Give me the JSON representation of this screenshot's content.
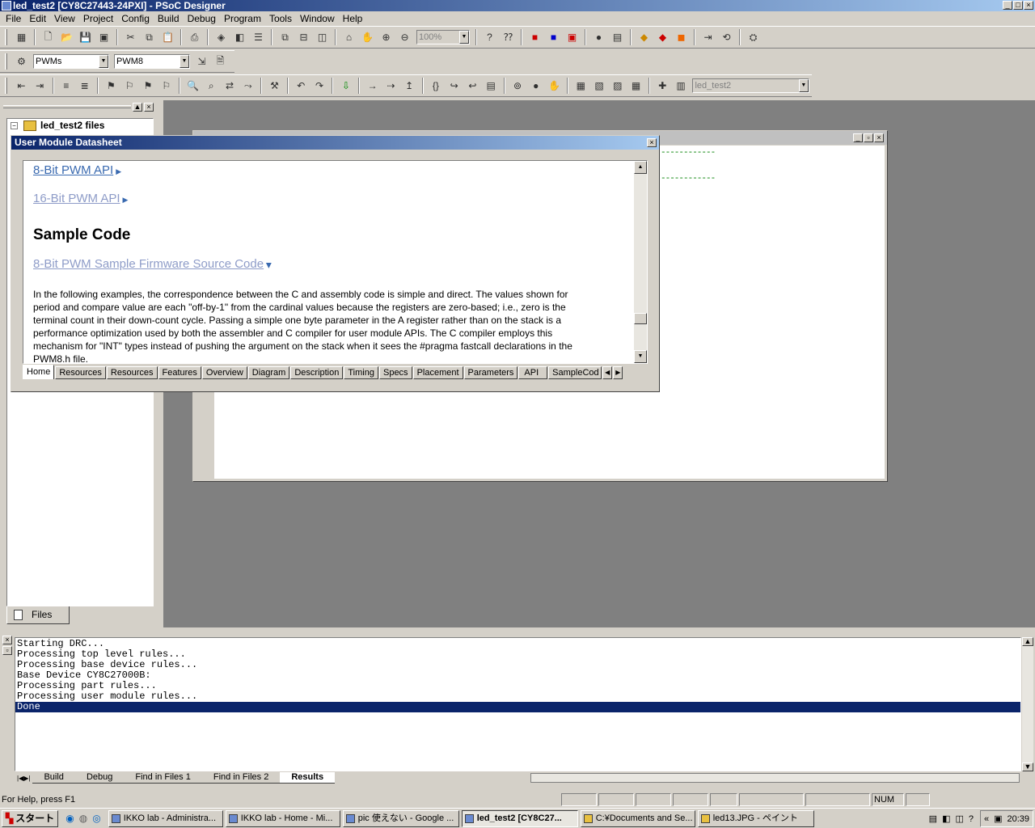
{
  "window": {
    "title": "led_test2 [CY8C27443-24PXI] - PSoC Designer"
  },
  "menu": [
    "File",
    "Edit",
    "View",
    "Project",
    "Config",
    "Build",
    "Debug",
    "Program",
    "Tools",
    "Window",
    "Help"
  ],
  "toolbar1": {
    "zoom_value": "100%"
  },
  "toolbar2": {
    "category": "PWMs",
    "module": "PWM8"
  },
  "toolbar3": {
    "project_combo": "led_test2"
  },
  "files_pane": {
    "root_label": "led_test2 files",
    "tab_label": "Files"
  },
  "editor": {
    "dashes1": "------------",
    "dashes2": "------------"
  },
  "datasheet": {
    "title": "User Module Datasheet",
    "links": {
      "api8": "8-Bit PWM API",
      "api16": "16-Bit PWM API",
      "sample": "8-Bit PWM Sample Firmware Source Code"
    },
    "heading": "Sample Code",
    "lines": [
      "In the following examples, the correspondence between the C and assembly code is simple and direct. The values shown for",
      "period and compare value are each \"off-by-1\" from the cardinal values because the registers are zero-based; i.e., zero is the",
      "terminal count in their down-count cycle. Passing a simple one byte parameter in the A register rather than on the stack is a",
      "performance optimization used by both the assembler and C compiler for user module APIs. The C compiler employs this",
      "mechanism for \"INT\" types instead of pushing the argument on the stack when it sees the #pragma fastcall declarations in the",
      "PWM8.h file."
    ],
    "tabs": [
      "Home",
      "Resources",
      "Resources",
      "Features",
      "Overview",
      "Diagram",
      "Description",
      "Timing",
      "Specs",
      "Placement",
      "Parameters",
      "API",
      "SampleCod"
    ]
  },
  "output": {
    "lines": [
      "Starting DRC...",
      "Processing top level rules...",
      "Processing base device rules...",
      "Base Device CY8C27000B:",
      "Processing part rules...",
      "Processing user module rules...",
      "Done"
    ],
    "tabs": [
      "Build",
      "Debug",
      "Find in Files 1",
      "Find in Files 2",
      "Results"
    ]
  },
  "status": {
    "help": "For Help, press F1",
    "num": "NUM"
  },
  "taskbar": {
    "start": "スタート",
    "items": [
      "IKKO lab - Administra...",
      "IKKO lab - Home - Mi...",
      "pic 使えない - Google ...",
      "led_test2 [CY8C27...",
      "C:¥Documents and Se...",
      "led13.JPG - ペイント"
    ],
    "time": "20:39"
  }
}
